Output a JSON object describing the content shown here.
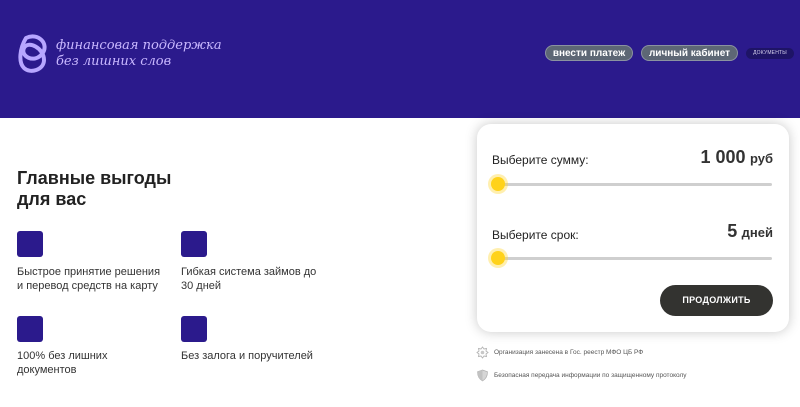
{
  "header": {
    "logo_line1": "финансовая поддержка",
    "logo_line2": "без лишних слов",
    "nav": {
      "pay_label": "внести платеж",
      "cabinet_label": "личный кабинет",
      "docs_label": "ДОКУМЕНТЫ"
    }
  },
  "benefits": {
    "title_line1": "Главные выгоды",
    "title_line2": "для вас",
    "items": [
      {
        "text": "Быстрое принятие решения и перевод средств на карту"
      },
      {
        "text": "Гибкая система займов до 30 дней"
      },
      {
        "text": "100% без лишних документов"
      },
      {
        "text": "Без залога и поручителей"
      }
    ]
  },
  "calculator": {
    "sum_label": "Выберите сумму:",
    "sum_value": "1 000",
    "sum_unit": "руб",
    "sum_slider_fraction": 0,
    "term_label": "Выберите срок:",
    "term_value": "5",
    "term_unit": "дней",
    "term_slider_fraction": 0,
    "continue_label": "ПРОДОЛЖИТЬ"
  },
  "notes": [
    {
      "text": "Организация занесена в Гос. реестр МФО ЦБ РФ",
      "icon": "emblem-icon"
    },
    {
      "text": "Безопасная передача информации по защищенному протоколу",
      "icon": "shield-icon"
    }
  ],
  "colors": {
    "brand": "#2b1a8c",
    "accent": "#ffd21a",
    "button_dark": "#333330"
  }
}
